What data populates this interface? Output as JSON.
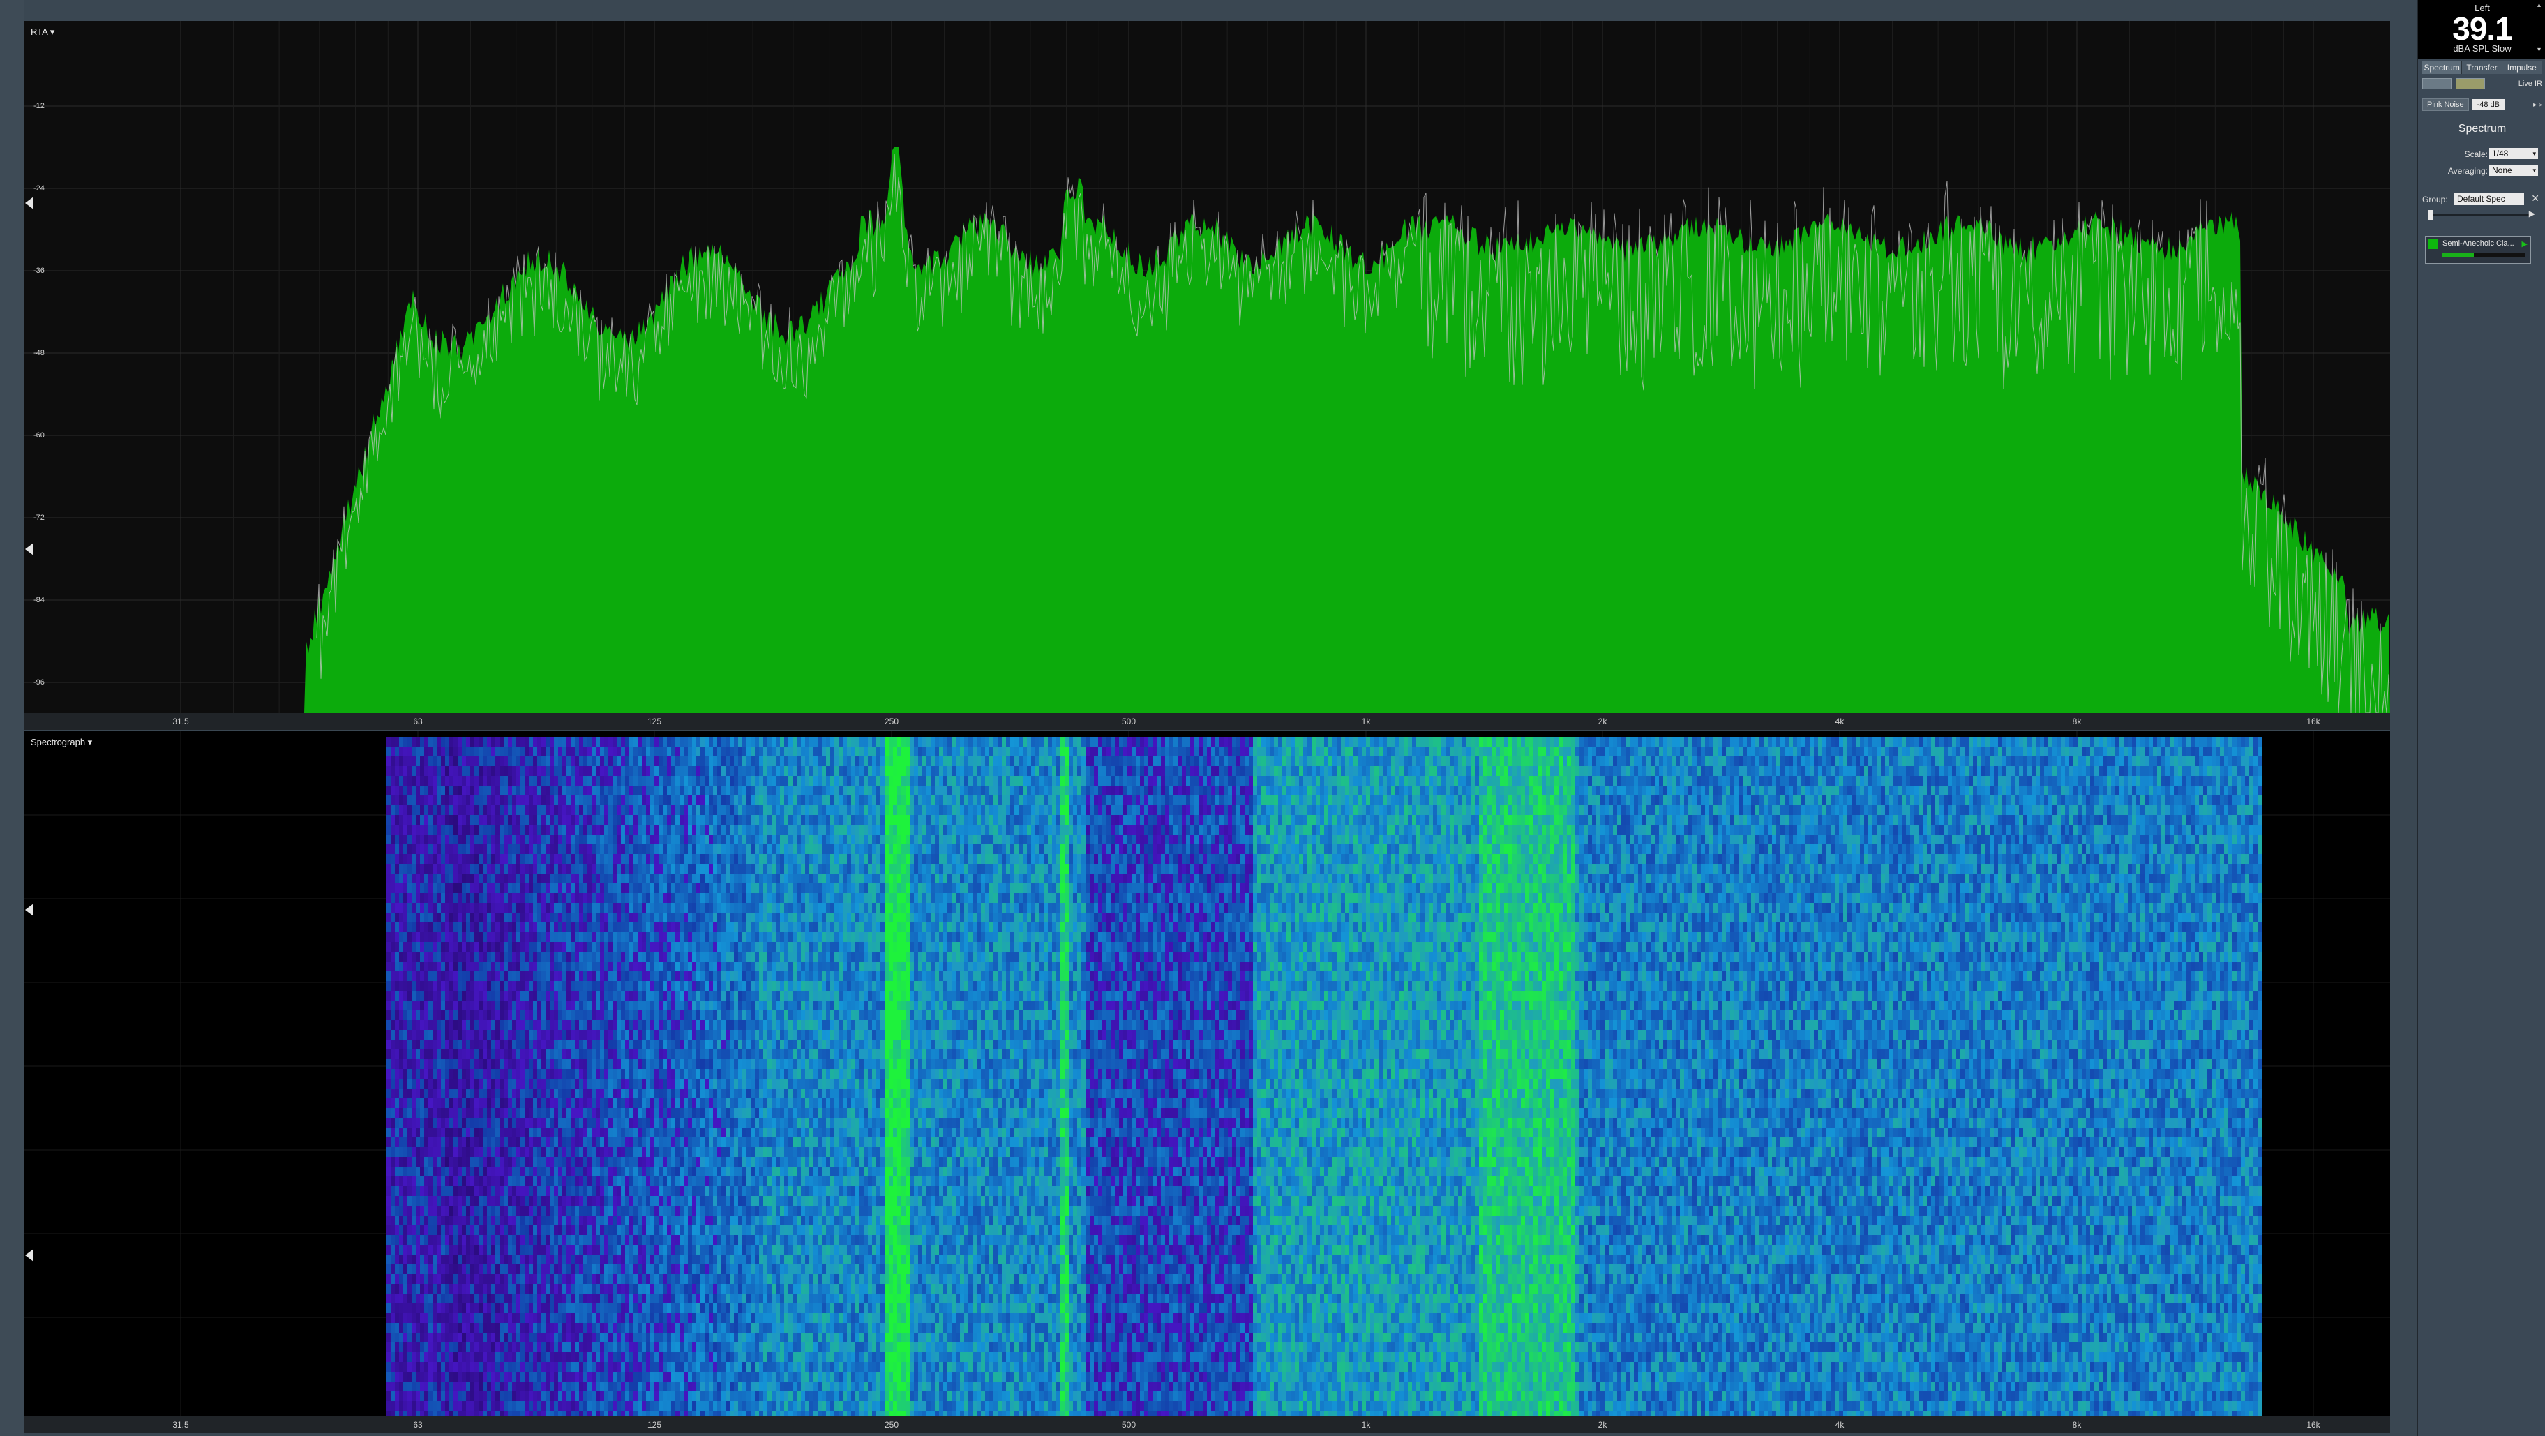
{
  "rta": {
    "title": "RTA ▾",
    "y_ticks": [
      "-12",
      "-24",
      "-36",
      "-48",
      "-60",
      "-72",
      "-84",
      "-96"
    ],
    "x_ticks": [
      "31.5",
      "63",
      "125",
      "250",
      "500",
      "1k",
      "2k",
      "4k",
      "8k",
      "16k"
    ],
    "fill_color": "#0cab0c",
    "trace_color": "#c8c8c8"
  },
  "spectrograph": {
    "title": "Spectrograph ▾",
    "x_ticks": [
      "31.5",
      "63",
      "125",
      "250",
      "500",
      "1k",
      "2k",
      "4k",
      "8k",
      "16k"
    ]
  },
  "meter": {
    "channel": "Left",
    "value": "39.1",
    "unit": "dBA SPL Slow"
  },
  "tabs": [
    "Spectrum",
    "Transfer",
    "Impulse"
  ],
  "mode": {
    "live_label": "Live IR"
  },
  "generator": {
    "signal": "Pink Noise",
    "level": "-48 dB",
    "arrows": "▸ ▹"
  },
  "spectrum_section": {
    "title": "Spectrum",
    "scale_label": "Scale:",
    "scale_value": "1/48",
    "averaging_label": "Averaging:",
    "averaging_value": "None"
  },
  "group": {
    "label": "Group:",
    "value": "Default Spec"
  },
  "measurement": {
    "name": "Semi-Anechoic Cla...",
    "color": "#0eb80e"
  }
}
